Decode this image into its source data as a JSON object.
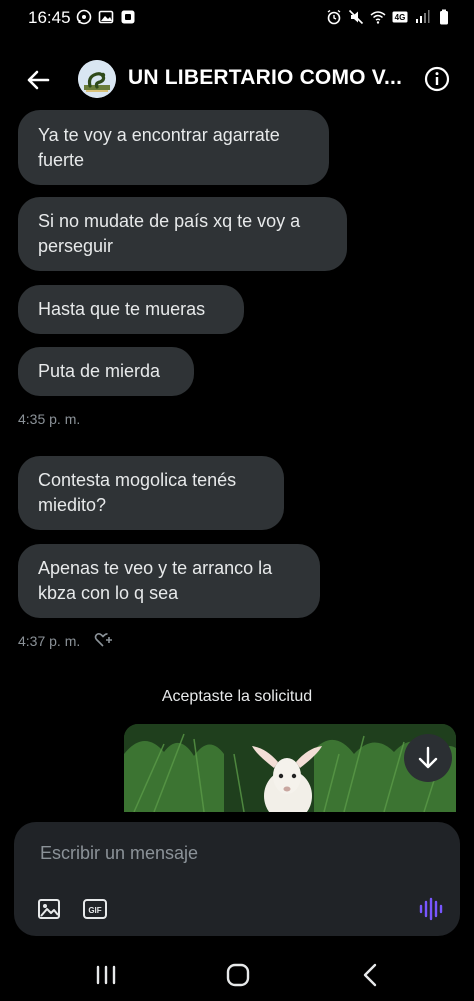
{
  "status_bar": {
    "time": "16:45",
    "left_icons": [
      "whatsapp-icon",
      "image-icon",
      "app-icon"
    ],
    "right_icons": [
      "alarm-icon",
      "mute-icon",
      "wifi-icon",
      "lte-icon",
      "signal-icon",
      "battery-icon"
    ],
    "lte_label": "4G"
  },
  "header": {
    "title": "UN LIBERTARIO COMO V...",
    "back_icon": "arrow-left-icon",
    "info_icon": "info-icon"
  },
  "messages": [
    {
      "lines": [
        "Ya te voy a encontrar agarrate",
        "fuerte"
      ]
    },
    {
      "lines": [
        "Si no mudate de país xq te voy a",
        "perseguir"
      ]
    },
    {
      "lines": [
        "Hasta que te mueras"
      ]
    },
    {
      "lines": [
        "Puta de mierda"
      ]
    }
  ],
  "timestamp_1": "4:35 p. m.",
  "messages_2": [
    {
      "lines": [
        "Contesta mogolica tenés",
        "miedito?"
      ]
    },
    {
      "lines": [
        "Apenas te veo y te arranco la",
        "kbza con lo q sea"
      ]
    }
  ],
  "timestamp_2": "4:37 p. m.",
  "system_note": "Aceptaste la solicitud",
  "composer": {
    "placeholder": "Escribir un mensaje",
    "gif_label": "GIF"
  },
  "colors": {
    "background": "#000000",
    "bubble": "#2f3336",
    "composer": "#202327",
    "voice_accent": "#7856ff"
  }
}
